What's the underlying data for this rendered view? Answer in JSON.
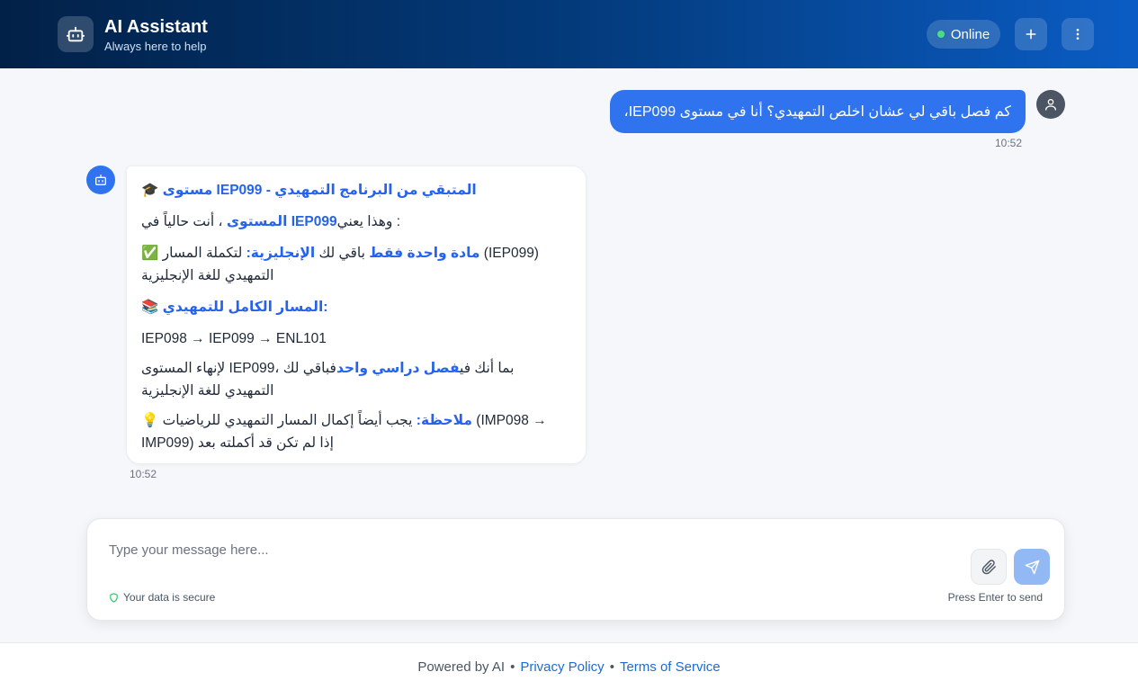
{
  "header": {
    "title": "AI Assistant",
    "subtitle": "Always here to help",
    "status": "Online",
    "new_chat_icon": "plus-icon",
    "menu_icon": "more-vertical-icon"
  },
  "messages": {
    "user": {
      "text": "كم فصل باقي لي عشان اخلص التمهيدي؟ أنا في مستوى IEP099،",
      "time": "10:52"
    },
    "assistant": {
      "heading_emoji": "🎓",
      "heading": "مستوى IEP099 - المتبقي من البرنامج التمهيدي",
      "line1_a": "وهذا يعني ",
      "line1_b": "IEP099",
      "line1_c": "، أنت حالياً في ",
      "line1_d": "المستوى",
      "line1_e": ":",
      "line2_emoji": "✅",
      "line2_a": "الإنجليزية:",
      "line2_b": " باقي لك ",
      "line2_c": "مادة واحدة فقط",
      "line2_d": " لتكملة المسار (IEP099)",
      "line2_e": "التمهيدي للغة الإنجليزية",
      "line3_emoji": "📚",
      "line3": "المسار الكامل للتمهيدي:",
      "path": "IEP098 → IEP099 → ENL101",
      "line4_a": "فباقي لك ",
      "line4_b": "فصل دراسي واحد",
      "line4_c": " لإنهاء المستوى IEP099، بما أنك في",
      "line4_d": "التمهيدي للغة الإنجليزية",
      "line5_emoji": "💡",
      "line5_a": "ملاحظة:",
      "line5_b": " يجب أيضاً إكمال المسار التمهيدي للرياضيات (IMP098 →",
      "line5_c": "IMP099) إذا لم تكن قد أكملته بعد",
      "time": "10:52"
    }
  },
  "composer": {
    "placeholder": "Type your message here...",
    "secure_note": "Your data is secure",
    "enter_hint": "Press Enter to send"
  },
  "footer": {
    "powered_by": "Powered by AI",
    "sep1": "•",
    "privacy": "Privacy Policy",
    "sep2": "•",
    "terms": "Terms of Service"
  },
  "colors": {
    "accent": "#2f73ef",
    "header_start": "#022148",
    "header_end": "#0a5cc4",
    "online": "#4ade80"
  }
}
